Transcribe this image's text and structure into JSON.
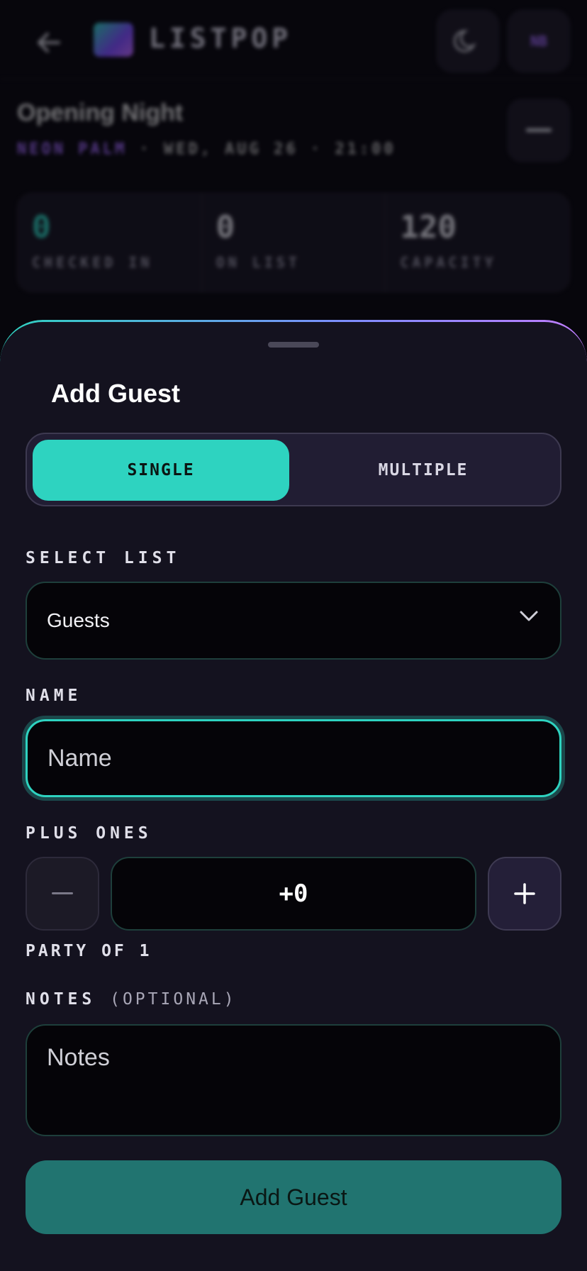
{
  "background": {
    "brand": "LISTPOP",
    "avatar_initials": "NB",
    "event": {
      "title": "Opening Night",
      "venue": "NEON PALM",
      "datetime": " · WED, AUG 26 · 21:00"
    },
    "stats": [
      {
        "value": "0",
        "label": "CHECKED IN"
      },
      {
        "value": "0",
        "label": "ON LIST"
      },
      {
        "value": "120",
        "label": "CAPACITY"
      }
    ]
  },
  "sheet": {
    "title": "Add Guest",
    "mode_tabs": {
      "single": "SINGLE",
      "multiple": "MULTIPLE",
      "selected": "SINGLE"
    },
    "select_list": {
      "label": "SELECT LIST",
      "value": "Guests"
    },
    "name": {
      "label": "NAME",
      "placeholder": "Name",
      "value": ""
    },
    "plus_ones": {
      "label": "PLUS ONES",
      "value": "+0",
      "party_text": "PARTY OF 1"
    },
    "notes": {
      "label": "NOTES",
      "optional": "(OPTIONAL)",
      "placeholder": "Notes",
      "value": ""
    },
    "submit_label": "Add Guest"
  },
  "colors": {
    "accent": "#2ed3c0",
    "submit": "#217470",
    "sheet_bg": "#14121f",
    "page_bg": "#07060c"
  },
  "icons": [
    "back-arrow-icon",
    "moon-icon",
    "chevron-down-icon",
    "minus-icon",
    "plus-icon",
    "collapse-minus-icon"
  ]
}
